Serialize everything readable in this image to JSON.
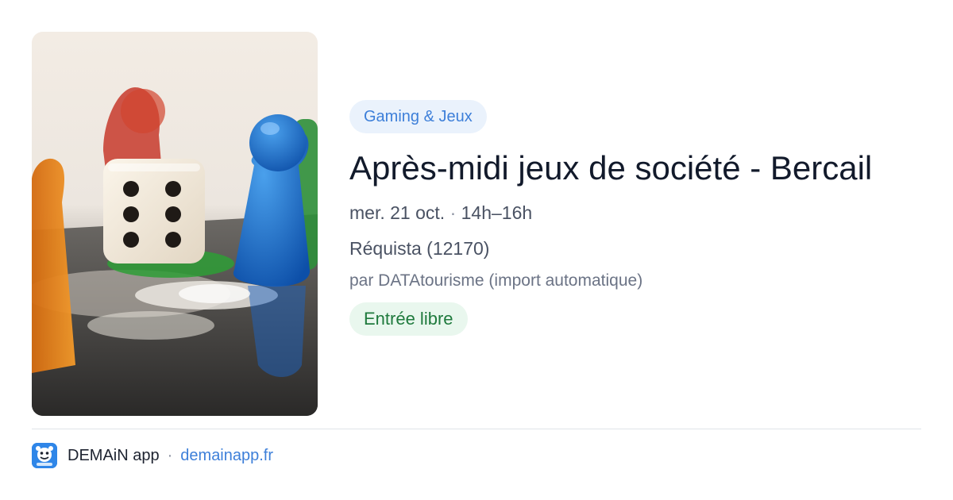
{
  "event": {
    "category": "Gaming & Jeux",
    "title": "Après-midi jeux de société - Bercail",
    "date": "mer. 21 oct.",
    "date_separator": "·",
    "time": "14h–16h",
    "location": "Réquista (12170)",
    "organizer": "par DATAtourisme (import automatique)",
    "price": "Entrée libre",
    "image_subject": "board game dice and pawns"
  },
  "footer": {
    "app_name": "DEMAiN app",
    "separator": "·",
    "domain": "demainapp.fr"
  },
  "colors": {
    "category_chip_bg": "#eaf2fc",
    "category_chip_text": "#3d7fd9",
    "price_chip_bg": "#e9f7ee",
    "price_chip_text": "#1f7a3d",
    "title_text": "#121a2b",
    "link": "#3d7fd9",
    "logo_bg": "#2f86e8"
  }
}
